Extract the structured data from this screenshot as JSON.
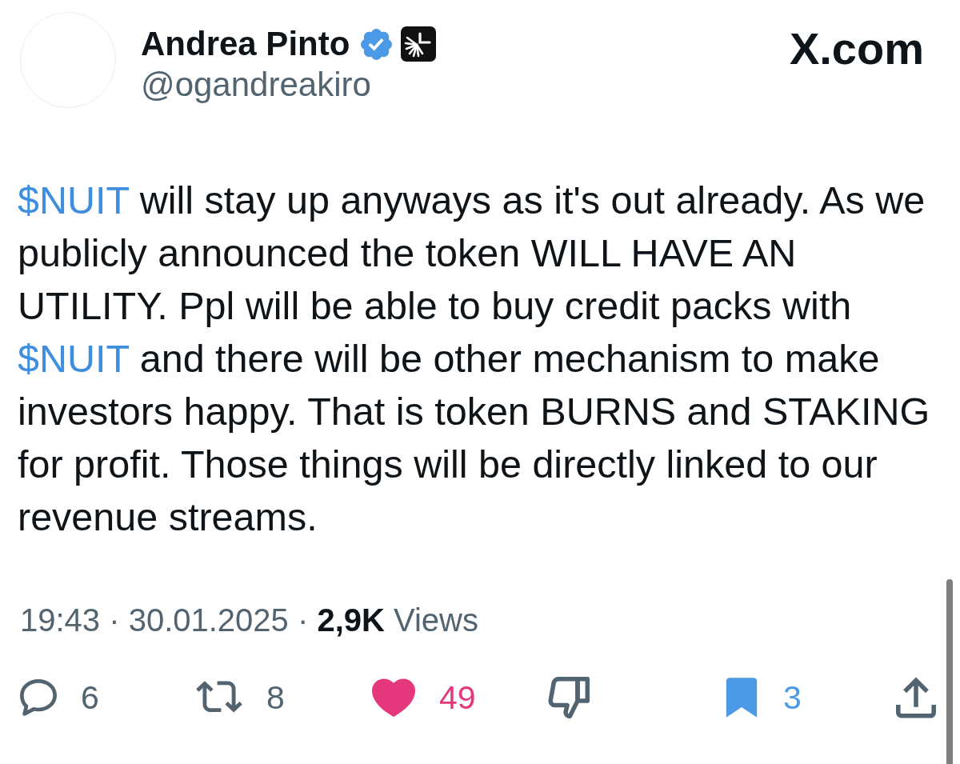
{
  "author": {
    "name": "Andrea Pinto",
    "verified": true,
    "affiliate": true,
    "handle": "@ogandreakiro"
  },
  "brand": "X.com",
  "tweet": {
    "lines": [
      [
        {
          "kind": "cashtag",
          "text": "$NUIT"
        },
        {
          "kind": "text",
          "text": " will stay up anyways as it's out already. As we"
        }
      ],
      [
        {
          "kind": "text",
          "text": "publicly announced the token WILL HAVE AN"
        }
      ],
      [
        {
          "kind": "text",
          "text": "UTILITY. Ppl will be able to buy credit packs with"
        }
      ],
      [
        {
          "kind": "cashtag",
          "text": "$NUIT"
        },
        {
          "kind": "text",
          "text": " and there will be other mechanism to make"
        }
      ],
      [
        {
          "kind": "text",
          "text": "investors happy. That is token BURNS and STAKING"
        }
      ],
      [
        {
          "kind": "text",
          "text": "for profit. Those things will be directly linked to our"
        }
      ],
      [
        {
          "kind": "text",
          "text": "revenue streams."
        }
      ]
    ]
  },
  "meta": "19:43 · 30.01.2025 · **2,9K** Views",
  "actions": [
    {
      "kind": "reply",
      "count": "6",
      "on": false
    },
    {
      "kind": "repost",
      "count": "8",
      "on": false
    },
    {
      "kind": "like",
      "count": "49",
      "on": true
    },
    {
      "kind": "dislike",
      "on": false
    },
    {
      "kind": "bookmark",
      "count": "3",
      "on": true
    },
    {
      "kind": "share",
      "on": false
    }
  ]
}
